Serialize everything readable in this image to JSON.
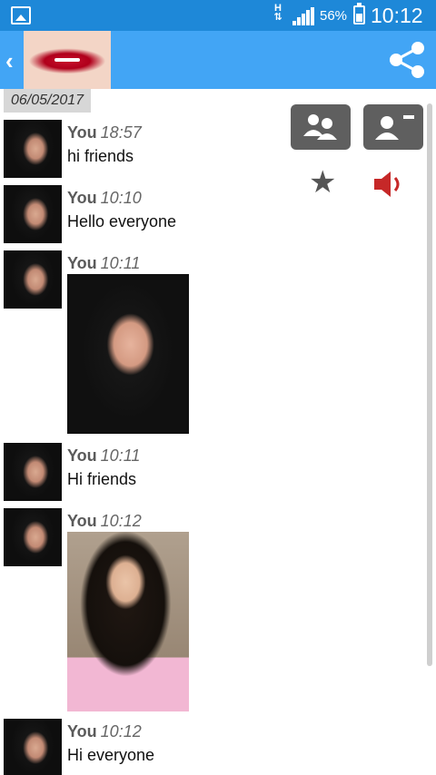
{
  "status_bar": {
    "network": "H",
    "battery_percent": "56%",
    "time": "10:12",
    "icons": [
      "gallery-icon",
      "signal-icon",
      "battery-icon"
    ]
  },
  "app_bar": {
    "back_icon": "chevron-left-icon",
    "share_icon": "share-icon"
  },
  "date": "06/05/2017",
  "actions": {
    "icons": [
      "group-contact-icon",
      "remove-contact-icon",
      "star-icon",
      "speaker-icon"
    ],
    "star_glyph": "★"
  },
  "messages": [
    {
      "sender": "You",
      "time": "18:57",
      "text": "hi friends"
    },
    {
      "sender": "You",
      "time": "10:10",
      "text": "Hello everyone"
    },
    {
      "sender": "You",
      "time": "10:11",
      "text": ""
    },
    {
      "sender": "You",
      "time": "10:11",
      "text": "Hi friends"
    },
    {
      "sender": "You",
      "time": "10:12",
      "text": ""
    },
    {
      "sender": "You",
      "time": "10:12",
      "text": "Hi everyone"
    }
  ],
  "colors": {
    "status_bar": "#1e88d8",
    "app_bar": "#42a5f5",
    "speaker": "#c62828",
    "action_button": "#5f5f5f"
  }
}
